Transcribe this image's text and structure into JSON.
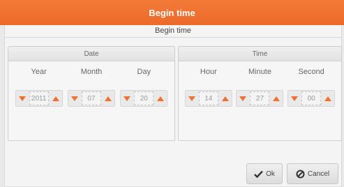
{
  "title": "Begin time",
  "subtitle": "Begin time",
  "date_panel": {
    "header": "Date",
    "fields": [
      {
        "label": "Year",
        "value": "2011"
      },
      {
        "label": "Month",
        "value": "07"
      },
      {
        "label": "Day",
        "value": "20"
      }
    ]
  },
  "time_panel": {
    "header": "Time",
    "fields": [
      {
        "label": "Hour",
        "value": "14"
      },
      {
        "label": "Minute",
        "value": "27"
      },
      {
        "label": "Second",
        "value": "00"
      }
    ]
  },
  "buttons": {
    "ok_label": "Ok",
    "cancel_label": "Cancel"
  },
  "colors": {
    "accent": "#ef6f2e",
    "arrow": "#f07030"
  },
  "icons": {
    "decrement": "down-triangle-icon",
    "increment": "up-triangle-icon",
    "ok": "check-icon",
    "cancel": "cancel-circle-icon"
  }
}
